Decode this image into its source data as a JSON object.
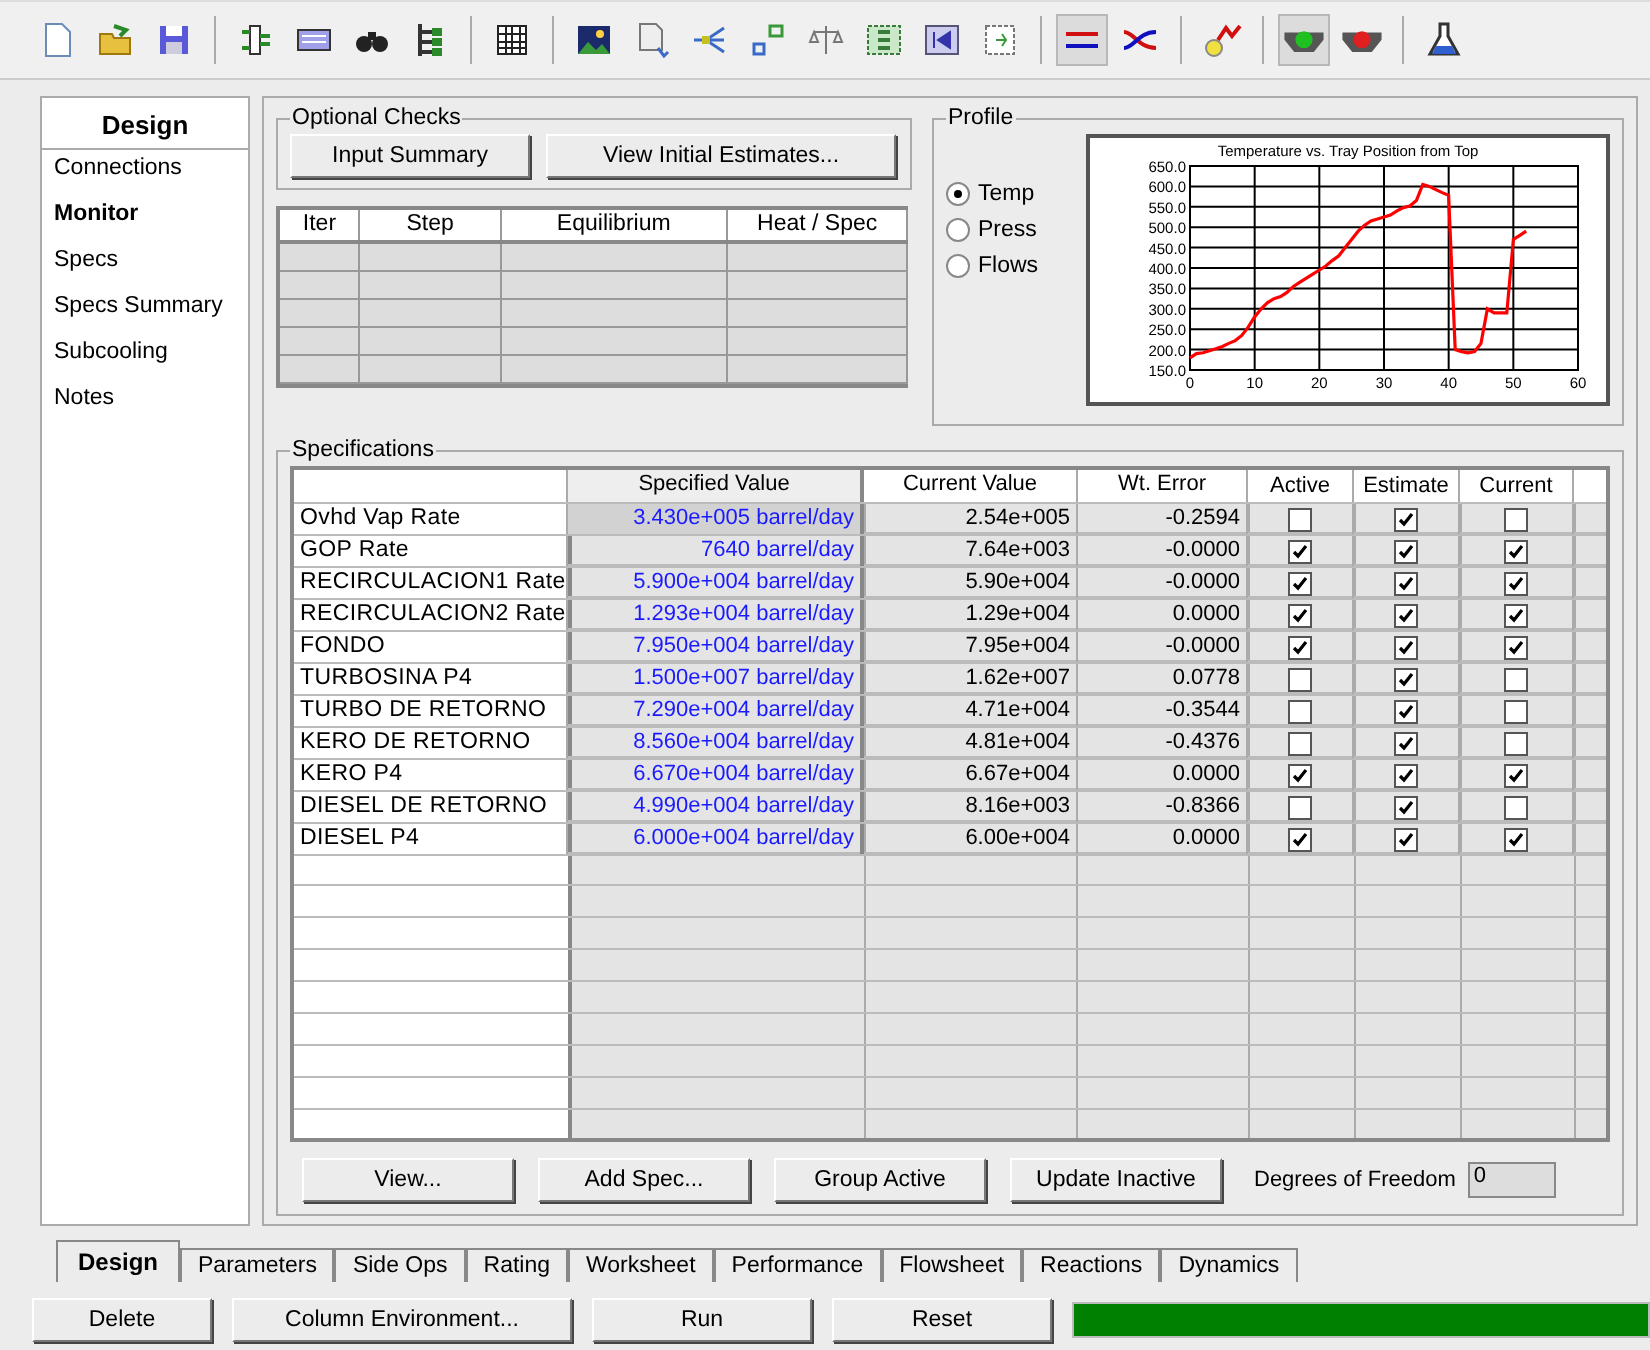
{
  "toolbar": [
    {
      "kind": "new",
      "pressed": false
    },
    {
      "kind": "open",
      "pressed": false
    },
    {
      "kind": "save",
      "pressed": false
    },
    {
      "kind": "sep"
    },
    {
      "kind": "column",
      "pressed": false
    },
    {
      "kind": "panel",
      "pressed": false
    },
    {
      "kind": "find",
      "pressed": false
    },
    {
      "kind": "tree",
      "pressed": false
    },
    {
      "kind": "sep"
    },
    {
      "kind": "grid",
      "pressed": false
    },
    {
      "kind": "sep"
    },
    {
      "kind": "image",
      "pressed": false
    },
    {
      "kind": "doc",
      "pressed": false
    },
    {
      "kind": "split",
      "pressed": false
    },
    {
      "kind": "nodes",
      "pressed": false
    },
    {
      "kind": "balance",
      "pressed": false
    },
    {
      "kind": "money",
      "pressed": false
    },
    {
      "kind": "rewind",
      "pressed": false
    },
    {
      "kind": "step",
      "pressed": false
    },
    {
      "kind": "sep"
    },
    {
      "kind": "lines",
      "pressed": true
    },
    {
      "kind": "cross",
      "pressed": false
    },
    {
      "kind": "sep"
    },
    {
      "kind": "bulb",
      "pressed": false
    },
    {
      "kind": "sep"
    },
    {
      "kind": "go",
      "pressed": true
    },
    {
      "kind": "stop",
      "pressed": false
    },
    {
      "kind": "sep"
    },
    {
      "kind": "flask",
      "pressed": false
    }
  ],
  "sidebar": {
    "title": "Design",
    "items": [
      {
        "label": "Connections",
        "selected": false
      },
      {
        "label": "Monitor",
        "selected": true
      },
      {
        "label": "Specs",
        "selected": false
      },
      {
        "label": "Specs Summary",
        "selected": false
      },
      {
        "label": "Subcooling",
        "selected": false
      },
      {
        "label": "Notes",
        "selected": false
      }
    ]
  },
  "optional_checks": {
    "title": "Optional Checks",
    "buttons": [
      "Input Summary",
      "View Initial Estimates..."
    ]
  },
  "monitor_table": {
    "columns": [
      "Iter",
      "Step",
      "Equilibrium",
      "Heat / Spec"
    ]
  },
  "profile": {
    "title": "Profile",
    "options": [
      {
        "label": "Temp",
        "selected": true
      },
      {
        "label": "Press",
        "selected": false
      },
      {
        "label": "Flows",
        "selected": false
      }
    ],
    "chart_data": {
      "type": "line",
      "title": "Temperature vs. Tray Position from Top",
      "x": [
        0,
        1,
        2,
        3,
        4,
        5,
        6,
        7,
        8,
        9,
        10,
        11,
        12,
        13,
        14,
        15,
        16,
        17,
        18,
        19,
        20,
        21,
        22,
        23,
        24,
        25,
        26,
        27,
        28,
        29,
        30,
        31,
        32,
        33,
        34,
        35,
        36,
        37,
        38,
        39,
        40,
        41,
        42,
        43,
        44,
        45,
        46,
        47,
        48,
        49,
        50,
        51,
        52
      ],
      "series": [
        {
          "color": "#ff0000",
          "values": [
            180,
            190,
            192,
            197,
            202,
            208,
            215,
            222,
            235,
            255,
            280,
            300,
            315,
            325,
            330,
            340,
            355,
            365,
            375,
            385,
            395,
            405,
            418,
            430,
            450,
            470,
            490,
            505,
            515,
            520,
            525,
            530,
            540,
            548,
            552,
            565,
            605,
            600,
            592,
            585,
            578,
            200,
            195,
            192,
            195,
            215,
            300,
            290,
            290,
            290,
            470,
            480,
            490
          ]
        }
      ],
      "xlim": [
        0,
        60
      ],
      "ylim": [
        150,
        650
      ],
      "grid": true,
      "xticks": [
        0,
        10,
        20,
        30,
        40,
        50,
        60
      ],
      "yticks": [
        {
          "value": 150,
          "label": "150.0"
        },
        {
          "value": 200,
          "label": "200.0"
        },
        {
          "value": 250,
          "label": "250.0"
        },
        {
          "value": 300,
          "label": "300.0"
        },
        {
          "value": 350,
          "label": "350.0"
        },
        {
          "value": 400,
          "label": "400.0"
        },
        {
          "value": 450,
          "label": "450.0"
        },
        {
          "value": 500,
          "label": "500.0"
        },
        {
          "value": 550,
          "label": "550.0"
        },
        {
          "value": 600,
          "label": "600.0"
        },
        {
          "value": 650,
          "label": "650.0"
        }
      ]
    }
  },
  "specifications": {
    "title": "Specifications",
    "columns": [
      "Specified Value",
      "Current Value",
      "Wt. Error",
      "Active",
      "Estimate",
      "Current"
    ],
    "rows": [
      {
        "name": "Ovhd Vap Rate",
        "specified": "3.430e+005 barrel/day",
        "current_value": "2.54e+005",
        "wt_error": "-0.2594",
        "active": false,
        "estimate": true,
        "current": false,
        "selected": true
      },
      {
        "name": "GOP Rate",
        "specified": "7640 barrel/day",
        "current_value": "7.64e+003",
        "wt_error": "-0.0000",
        "active": true,
        "estimate": true,
        "current": true,
        "selected": false
      },
      {
        "name": "RECIRCULACION1 Rate",
        "specified": "5.900e+004 barrel/day",
        "current_value": "5.90e+004",
        "wt_error": "-0.0000",
        "active": true,
        "estimate": true,
        "current": true,
        "selected": false
      },
      {
        "name": "RECIRCULACION2 Rate",
        "specified": "1.293e+004 barrel/day",
        "current_value": "1.29e+004",
        "wt_error": "0.0000",
        "active": true,
        "estimate": true,
        "current": true,
        "selected": false
      },
      {
        "name": "FONDO",
        "specified": "7.950e+004 barrel/day",
        "current_value": "7.95e+004",
        "wt_error": "-0.0000",
        "active": true,
        "estimate": true,
        "current": true,
        "selected": false
      },
      {
        "name": "TURBOSINA P4",
        "specified": "1.500e+007 barrel/day",
        "current_value": "1.62e+007",
        "wt_error": "0.0778",
        "active": false,
        "estimate": true,
        "current": false,
        "selected": false
      },
      {
        "name": "TURBO DE RETORNO",
        "specified": "7.290e+004 barrel/day",
        "current_value": "4.71e+004",
        "wt_error": "-0.3544",
        "active": false,
        "estimate": true,
        "current": false,
        "selected": false
      },
      {
        "name": "KERO DE RETORNO",
        "specified": "8.560e+004 barrel/day",
        "current_value": "4.81e+004",
        "wt_error": "-0.4376",
        "active": false,
        "estimate": true,
        "current": false,
        "selected": false
      },
      {
        "name": "KERO P4",
        "specified": "6.670e+004 barrel/day",
        "current_value": "6.67e+004",
        "wt_error": "0.0000",
        "active": true,
        "estimate": true,
        "current": true,
        "selected": false
      },
      {
        "name": "DIESEL DE RETORNO",
        "specified": "4.990e+004 barrel/day",
        "current_value": "8.16e+003",
        "wt_error": "-0.8366",
        "active": false,
        "estimate": true,
        "current": false,
        "selected": false
      },
      {
        "name": "DIESEL P4",
        "specified": "6.000e+004 barrel/day",
        "current_value": "6.00e+004",
        "wt_error": "0.0000",
        "active": true,
        "estimate": true,
        "current": true,
        "selected": false
      }
    ],
    "buttons": [
      "View...",
      "Add Spec...",
      "Group Active",
      "Update Inactive"
    ],
    "degrees_of_freedom": {
      "label": "Degrees of Freedom",
      "value": "0"
    }
  },
  "tabs": [
    {
      "label": "Design",
      "selected": true
    },
    {
      "label": "Parameters",
      "selected": false
    },
    {
      "label": "Side Ops",
      "selected": false
    },
    {
      "label": "Rating",
      "selected": false
    },
    {
      "label": "Worksheet",
      "selected": false
    },
    {
      "label": "Performance",
      "selected": false
    },
    {
      "label": "Flowsheet",
      "selected": false
    },
    {
      "label": "Reactions",
      "selected": false
    },
    {
      "label": "Dynamics",
      "selected": false
    }
  ],
  "bottom_buttons": [
    "Delete",
    "Column Environment...",
    "Run",
    "Reset"
  ],
  "progress": {
    "level": 1
  }
}
